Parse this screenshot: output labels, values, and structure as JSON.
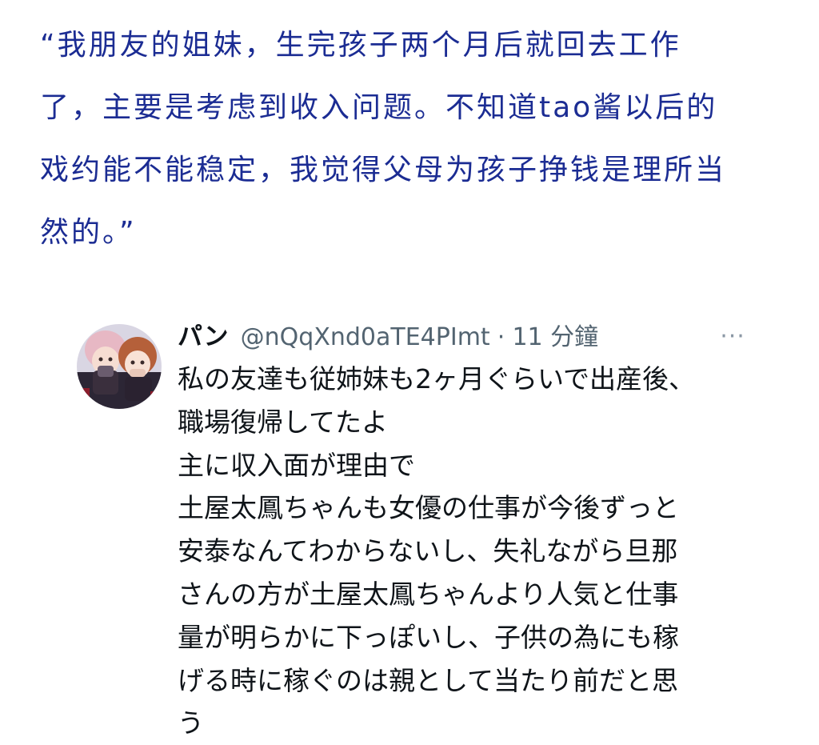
{
  "quote": {
    "lines": [
      "“我朋友的姐妹，生完孩子两个月后就回去工作",
      "了，主要是考虑到收入问题。不知道tao酱以后的",
      "戏约能不能稳定，我觉得父母为孩子挣钱是理所当",
      "然的。”"
    ]
  },
  "tweet": {
    "display_name": "パン",
    "handle": "@nQqXnd0aTE4PImt",
    "separator": "·",
    "timestamp": "11 分鐘",
    "more_icon": "more-horizontal-icon",
    "more_glyph": "···",
    "body_lines": [
      "私の友達も従姉妹も2ヶ月ぐらいで出産後、",
      "職場復帰してたよ",
      "主に収入面が理由で",
      "土屋太鳳ちゃんも女優の仕事が今後ずっと",
      "安泰なんてわからないし、失礼ながら旦那",
      "さんの方が土屋太鳳ちゃんより人気と仕事",
      "量が明らかに下っぽいし、子供の為にも稼",
      "げる時に稼ぐのは親として当たり前だと思",
      "う"
    ]
  },
  "colors": {
    "quote_text": "#1b2c93",
    "name_text": "#0f1419",
    "meta_text": "#536471"
  }
}
